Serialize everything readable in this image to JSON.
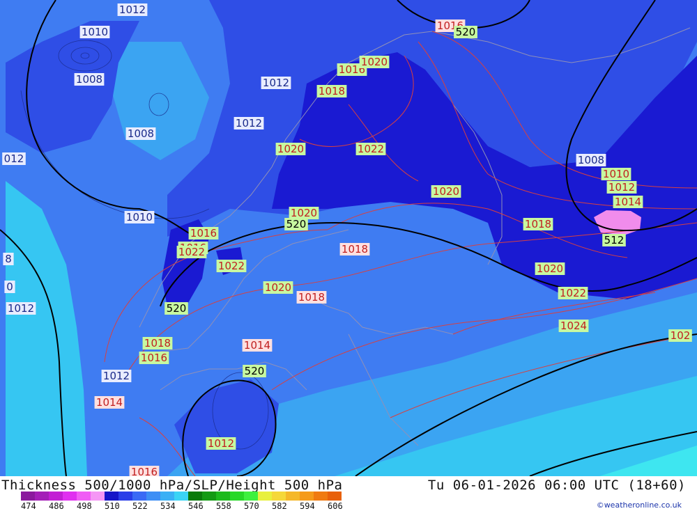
{
  "header": {
    "left": "Thickness 500/1000 hPa/SLP/Height 500 hPa",
    "right": "Tu 06-01-2026 06:00 UTC (18+60)"
  },
  "credit": "©weatheronline.co.uk",
  "legend": {
    "ticks": [
      "474",
      "486",
      "498",
      "510",
      "522",
      "534",
      "546",
      "558",
      "570",
      "582",
      "594",
      "606"
    ],
    "colors": [
      "#8b1a9e",
      "#a41fb8",
      "#c21fd4",
      "#e02ff0",
      "#f05cf5",
      "#f596f5",
      "#1515c8",
      "#2a3ee8",
      "#3a6af5",
      "#3d8ef5",
      "#3ab0f5",
      "#3ad4f5",
      "#0a7a0a",
      "#139a13",
      "#1cba1c",
      "#27d827",
      "#3ef03e",
      "#e8f03e",
      "#f5d83a",
      "#f5b82a",
      "#f59a1a",
      "#f07a10",
      "#e8600a"
    ]
  },
  "map": {
    "colors": {
      "t510": "#1a1ad2",
      "t516": "#2f4ee6",
      "t522": "#3f7cf2",
      "t528": "#3ba4f2",
      "t534": "#36c6f2",
      "t540": "#3ee6f0",
      "t504": "#f08cec",
      "slp_line": "#d84040",
      "height_line": "#000000",
      "coast": "#9090b8"
    },
    "labels": [
      {
        "text": "1012",
        "kind": "slp_low"
      },
      {
        "text": "1010",
        "kind": "slp_low"
      },
      {
        "text": "1008",
        "kind": "slp_low"
      },
      {
        "text": "1012",
        "kind": "slp_low"
      },
      {
        "text": "1012",
        "kind": "slp_low"
      },
      {
        "text": "1008",
        "kind": "slp_low"
      },
      {
        "text": "012",
        "kind": "slp_low"
      },
      {
        "text": "1010",
        "kind": "slp_low"
      },
      {
        "text": "1016",
        "kind": "slp_high"
      },
      {
        "text": "520",
        "kind": "height"
      },
      {
        "text": "1020",
        "kind": "slp_high"
      },
      {
        "text": "1016",
        "kind": "slp_high"
      },
      {
        "text": "1018",
        "kind": "slp_high"
      },
      {
        "text": "1020",
        "kind": "slp_high"
      },
      {
        "text": "1022",
        "kind": "slp_high"
      },
      {
        "text": "1020",
        "kind": "slp_high"
      },
      {
        "text": "1020",
        "kind": "slp_high"
      },
      {
        "text": "520",
        "kind": "height"
      },
      {
        "text": "1016",
        "kind": "slp_high"
      },
      {
        "text": "1022",
        "kind": "slp_high"
      },
      {
        "text": "1022",
        "kind": "slp_high"
      },
      {
        "text": "520",
        "kind": "height"
      },
      {
        "text": "1020",
        "kind": "slp_high"
      },
      {
        "text": "1018",
        "kind": "slp_mid"
      },
      {
        "text": "1018",
        "kind": "slp_mid"
      },
      {
        "text": "1018",
        "kind": "slp_high"
      },
      {
        "text": "1016",
        "kind": "slp_high"
      },
      {
        "text": "1014",
        "kind": "slp_mid"
      },
      {
        "text": "1012",
        "kind": "slp_low"
      },
      {
        "text": "1014",
        "kind": "slp_mid"
      },
      {
        "text": "520",
        "kind": "height"
      },
      {
        "text": "1012",
        "kind": "slp_high"
      },
      {
        "text": "1016",
        "kind": "slp_mid"
      },
      {
        "text": "1012",
        "kind": "slp_low"
      },
      {
        "text": "8",
        "kind": "slp_low"
      },
      {
        "text": "0",
        "kind": "slp_low"
      },
      {
        "text": "1008",
        "kind": "slp_low"
      },
      {
        "text": "1010",
        "kind": "slp_high"
      },
      {
        "text": "1012",
        "kind": "slp_high"
      },
      {
        "text": "1014",
        "kind": "slp_high"
      },
      {
        "text": "512",
        "kind": "height"
      },
      {
        "text": "1018",
        "kind": "slp_high"
      },
      {
        "text": "1020",
        "kind": "slp_high"
      },
      {
        "text": "1022",
        "kind": "slp_high"
      },
      {
        "text": "1024",
        "kind": "slp_high"
      },
      {
        "text": "102",
        "kind": "slp_high"
      },
      {
        "text": "1016",
        "kind": "slp_mid"
      },
      {
        "text": "520",
        "kind": "height"
      }
    ]
  }
}
